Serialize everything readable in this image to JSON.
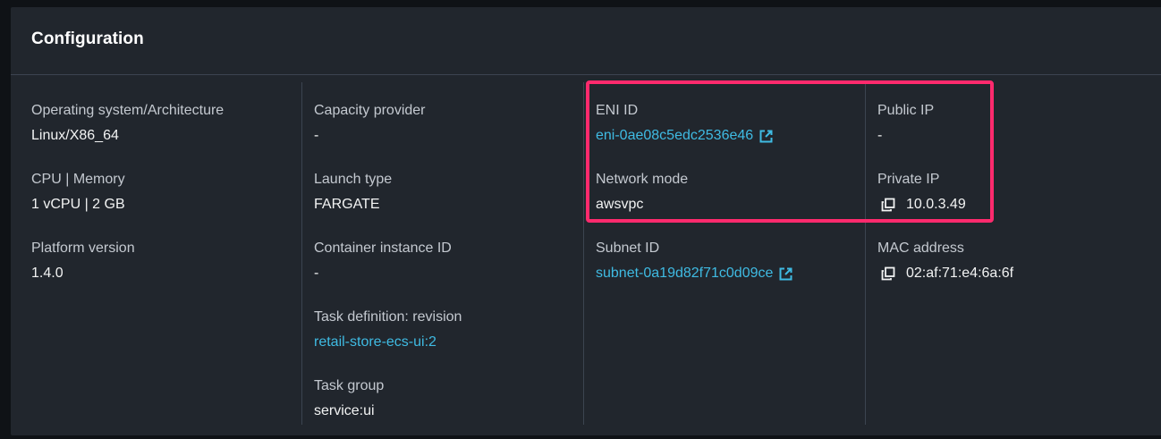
{
  "panel": {
    "title": "Configuration"
  },
  "columns": [
    {
      "fields": [
        {
          "label": "Operating system/Architecture",
          "value": "Linux/X86_64"
        },
        {
          "label": "CPU | Memory",
          "value": "1 vCPU | 2 GB"
        },
        {
          "label": "Platform version",
          "value": "1.4.0"
        }
      ]
    },
    {
      "fields": [
        {
          "label": "Capacity provider",
          "value": "-"
        },
        {
          "label": "Launch type",
          "value": "FARGATE"
        },
        {
          "label": "Container instance ID",
          "value": "-"
        },
        {
          "label": "Task definition: revision",
          "value": "retail-store-ecs-ui:2"
        },
        {
          "label": "Task group",
          "value": "service:ui"
        }
      ]
    },
    {
      "fields": [
        {
          "label": "ENI ID",
          "value": "eni-0ae08c5edc2536e46"
        },
        {
          "label": "Network mode",
          "value": "awsvpc"
        },
        {
          "label": "Subnet ID",
          "value": "subnet-0a19d82f71c0d09ce"
        }
      ]
    },
    {
      "fields": [
        {
          "label": "Public IP",
          "value": "-"
        },
        {
          "label": "Private IP",
          "value": "10.0.3.49"
        },
        {
          "label": "MAC address",
          "value": "02:af:71:e4:6a:6f"
        }
      ]
    }
  ],
  "icons": {
    "external_link": "external-link-icon",
    "copy": "copy-icon"
  },
  "colors": {
    "link": "#3fbbe3",
    "highlight": "#ff2a6d",
    "panel_bg": "#21262d"
  }
}
